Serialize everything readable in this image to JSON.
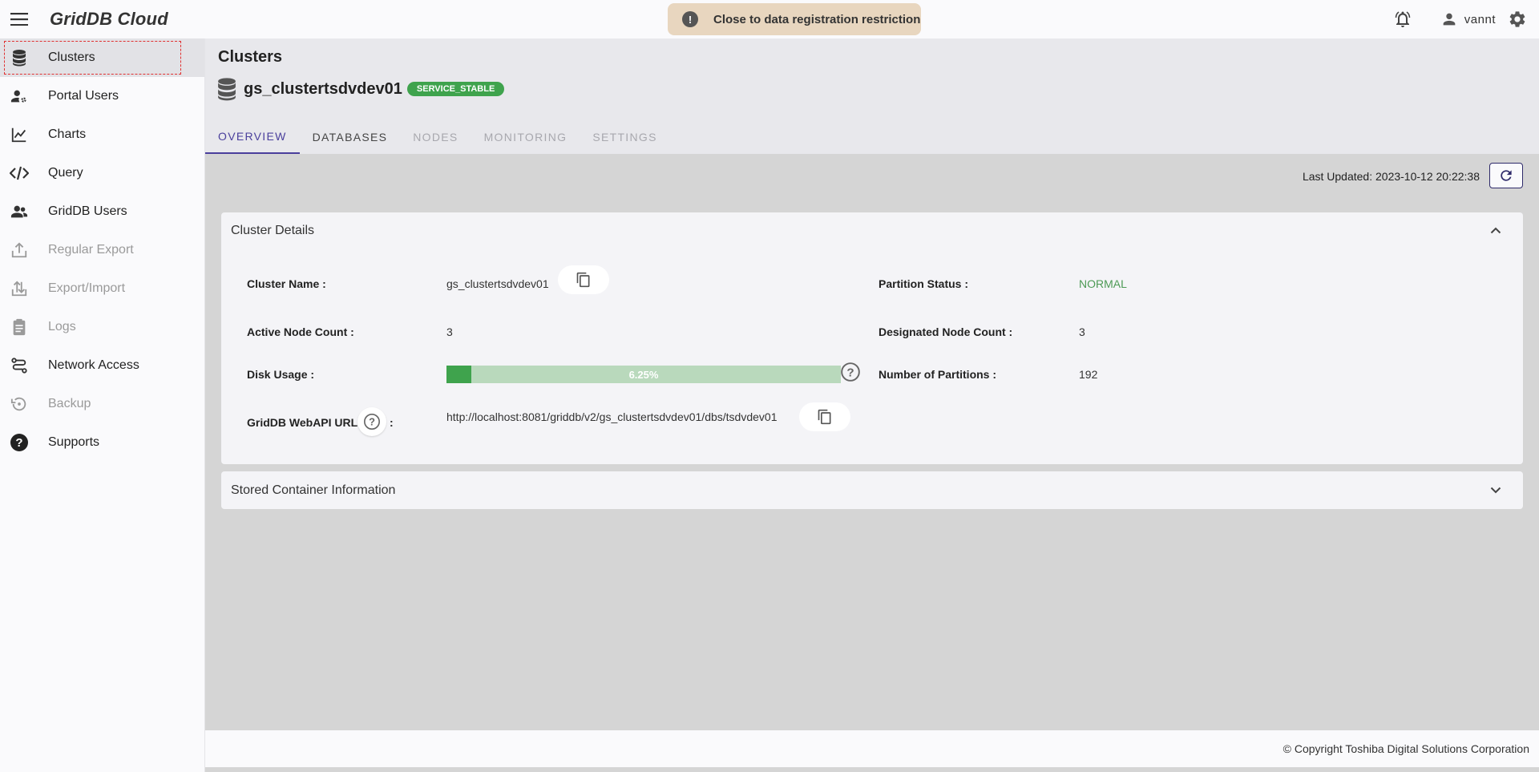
{
  "app": {
    "brand": "GridDB Cloud"
  },
  "notice": {
    "text": "Close to data registration restriction"
  },
  "user": {
    "name": "vannt"
  },
  "sidebar": {
    "items": [
      {
        "label": "Clusters"
      },
      {
        "label": "Portal Users"
      },
      {
        "label": "Charts"
      },
      {
        "label": "Query"
      },
      {
        "label": "GridDB Users"
      },
      {
        "label": "Regular Export"
      },
      {
        "label": "Export/Import"
      },
      {
        "label": "Logs"
      },
      {
        "label": "Network Access"
      },
      {
        "label": "Backup"
      },
      {
        "label": "Supports"
      }
    ]
  },
  "header": {
    "title": "Clusters",
    "cluster_name": "gs_clustertsdvdev01",
    "status": "SERVICE_STABLE"
  },
  "tabs": [
    {
      "label": "OVERVIEW"
    },
    {
      "label": "DATABASES"
    },
    {
      "label": "NODES"
    },
    {
      "label": "MONITORING"
    },
    {
      "label": "SETTINGS"
    }
  ],
  "overview": {
    "last_updated": "Last Updated: 2023-10-12 20:22:38",
    "cluster_details": {
      "title": "Cluster Details",
      "cluster_name_label": "Cluster Name :",
      "cluster_name_value": "gs_clustertsdvdev01",
      "partition_status_label": "Partition Status :",
      "partition_status_value": "NORMAL",
      "active_node_label": "Active Node Count :",
      "active_node_value": "3",
      "designated_node_label": "Designated Node Count :",
      "designated_node_value": "3",
      "disk_usage_label": "Disk Usage :",
      "disk_usage_text": "6.25%",
      "disk_usage_fraction": 0.0625,
      "partitions_label": "Number of Partitions :",
      "partitions_value": "192",
      "webapi_label": "GridDB WebAPI URL",
      "webapi_colon": ":",
      "webapi_value": "http://localhost:8081/griddb/v2/gs_clustertsdvdev01/dbs/tsdvdev01"
    },
    "stored_container": {
      "title": "Stored Container Information"
    }
  },
  "footer": {
    "copyright": "© Copyright Toshiba Digital Solutions Corporation"
  },
  "colors": {
    "accent": "#4a3f9c",
    "status_green": "#3fa34d",
    "notice_bg": "#e8d6bf"
  }
}
